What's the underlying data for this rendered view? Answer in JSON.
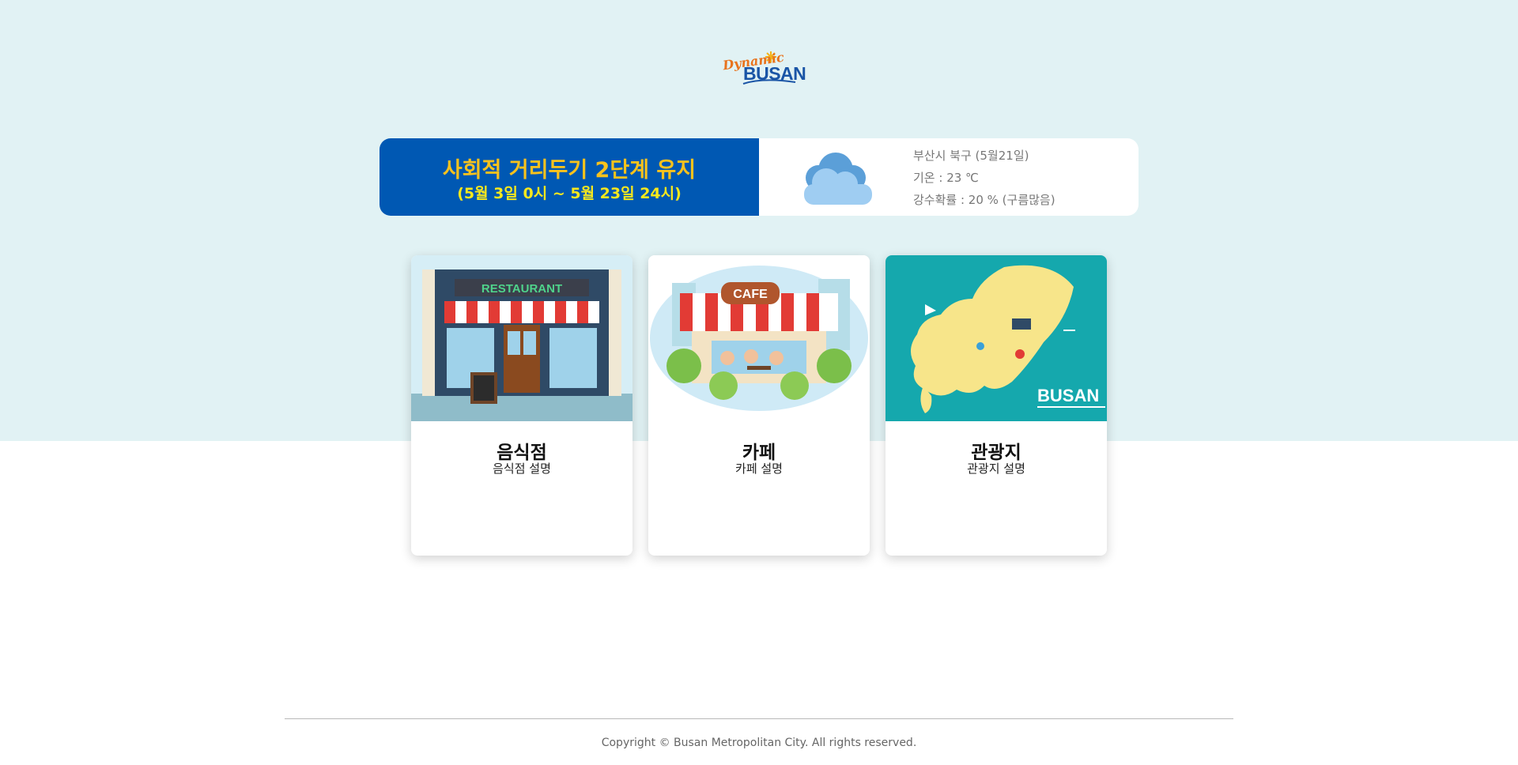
{
  "logo": {
    "line1": "Dynamic",
    "line2": "BUSAN"
  },
  "notice": {
    "title": "사회적 거리두기 2단계 유지",
    "period": "(5월 3일 0시 ~ 5월 23일 24시)"
  },
  "weather": {
    "icon": "cloud-icon",
    "location": "부산시 북구 (5월21일)",
    "temperature": "기온 : 23 ℃",
    "precipitation": "강수확률 : 20 % (구름많음)"
  },
  "cards": [
    {
      "title": "음식점",
      "desc": "음식점 설명",
      "sign": "RESTAURANT"
    },
    {
      "title": "카페",
      "desc": "카페 설명",
      "sign": "CAFE"
    },
    {
      "title": "관광지",
      "desc": "관광지 설명",
      "sign": "BUSAN"
    }
  ],
  "colors": {
    "notice_bg": "#0058b3",
    "notice_title": "#f7c21d",
    "header_bg": "#e1f2f4",
    "map_bg": "#15a8ad"
  },
  "footer": {
    "copyright": "Copyright © Busan Metropolitan City. All rights reserved."
  }
}
